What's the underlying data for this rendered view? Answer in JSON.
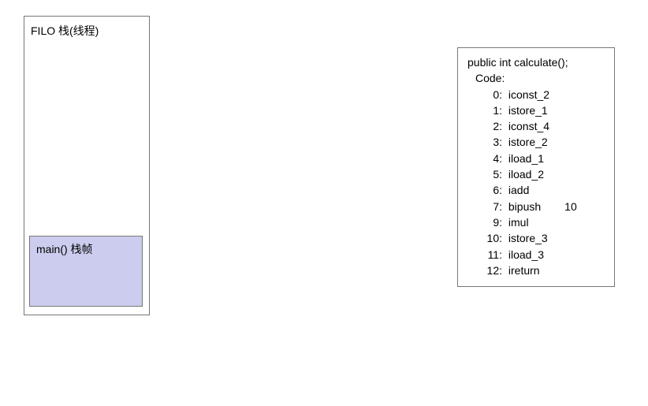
{
  "stack": {
    "title": "FILO  栈(线程)",
    "frame_label": "main() 栈帧"
  },
  "code": {
    "signature": "public int calculate();",
    "label": "Code:",
    "instructions": [
      {
        "idx": "0",
        "op": "iconst_2",
        "arg": ""
      },
      {
        "idx": "1",
        "op": "istore_1",
        "arg": ""
      },
      {
        "idx": "2",
        "op": "iconst_4",
        "arg": ""
      },
      {
        "idx": "3",
        "op": "istore_2",
        "arg": ""
      },
      {
        "idx": "4",
        "op": "iload_1",
        "arg": ""
      },
      {
        "idx": "5",
        "op": "iload_2",
        "arg": ""
      },
      {
        "idx": "6",
        "op": "iadd",
        "arg": ""
      },
      {
        "idx": "7",
        "op": "bipush",
        "arg": "10"
      },
      {
        "idx": "9",
        "op": "imul",
        "arg": ""
      },
      {
        "idx": "10",
        "op": "istore_3",
        "arg": ""
      },
      {
        "idx": "11",
        "op": "iload_3",
        "arg": ""
      },
      {
        "idx": "12",
        "op": "ireturn",
        "arg": ""
      }
    ]
  }
}
